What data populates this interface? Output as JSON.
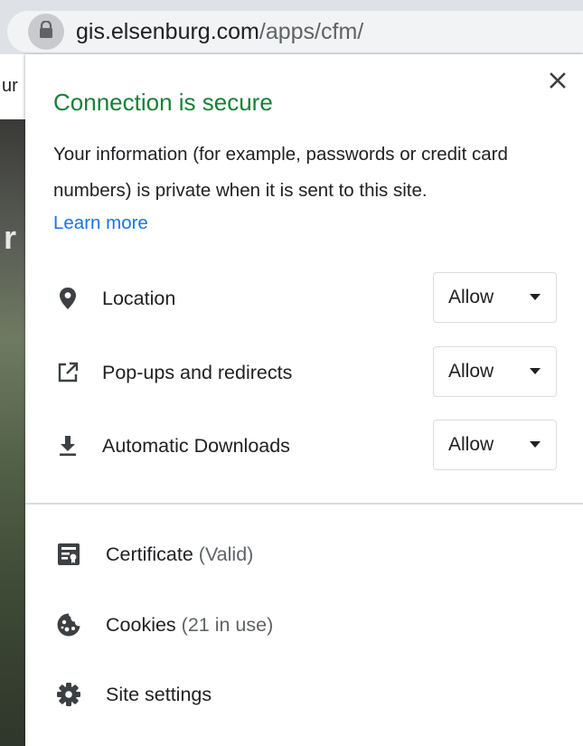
{
  "address_bar": {
    "host": "gis.elsenburg.com",
    "path": "/apps/cfm/",
    "lock_icon": "lock-icon"
  },
  "background_page": {
    "partial_text": "ur",
    "partial_letter": "r"
  },
  "popup": {
    "title": "Connection is secure",
    "description": "Your information (for example, passwords or credit card numbers) is private when it is sent to this site.",
    "learn_more": "Learn more",
    "permissions": [
      {
        "label": "Location",
        "value": "Allow",
        "icon": "location-pin-icon"
      },
      {
        "label": "Pop-ups and redirects",
        "value": "Allow",
        "icon": "external-link-icon"
      },
      {
        "label": "Automatic Downloads",
        "value": "Allow",
        "icon": "download-icon"
      }
    ],
    "links": [
      {
        "label": "Certificate",
        "sub": "(Valid)",
        "icon": "certificate-icon"
      },
      {
        "label": "Cookies",
        "sub": "(21 in use)",
        "icon": "cookie-icon"
      },
      {
        "label": "Site settings",
        "sub": "",
        "icon": "gear-icon"
      }
    ]
  },
  "colors": {
    "secure_green": "#188038",
    "link_blue": "#1a73e8",
    "text": "#202124",
    "secondary_text": "#5f6368",
    "border": "#dadce0"
  }
}
